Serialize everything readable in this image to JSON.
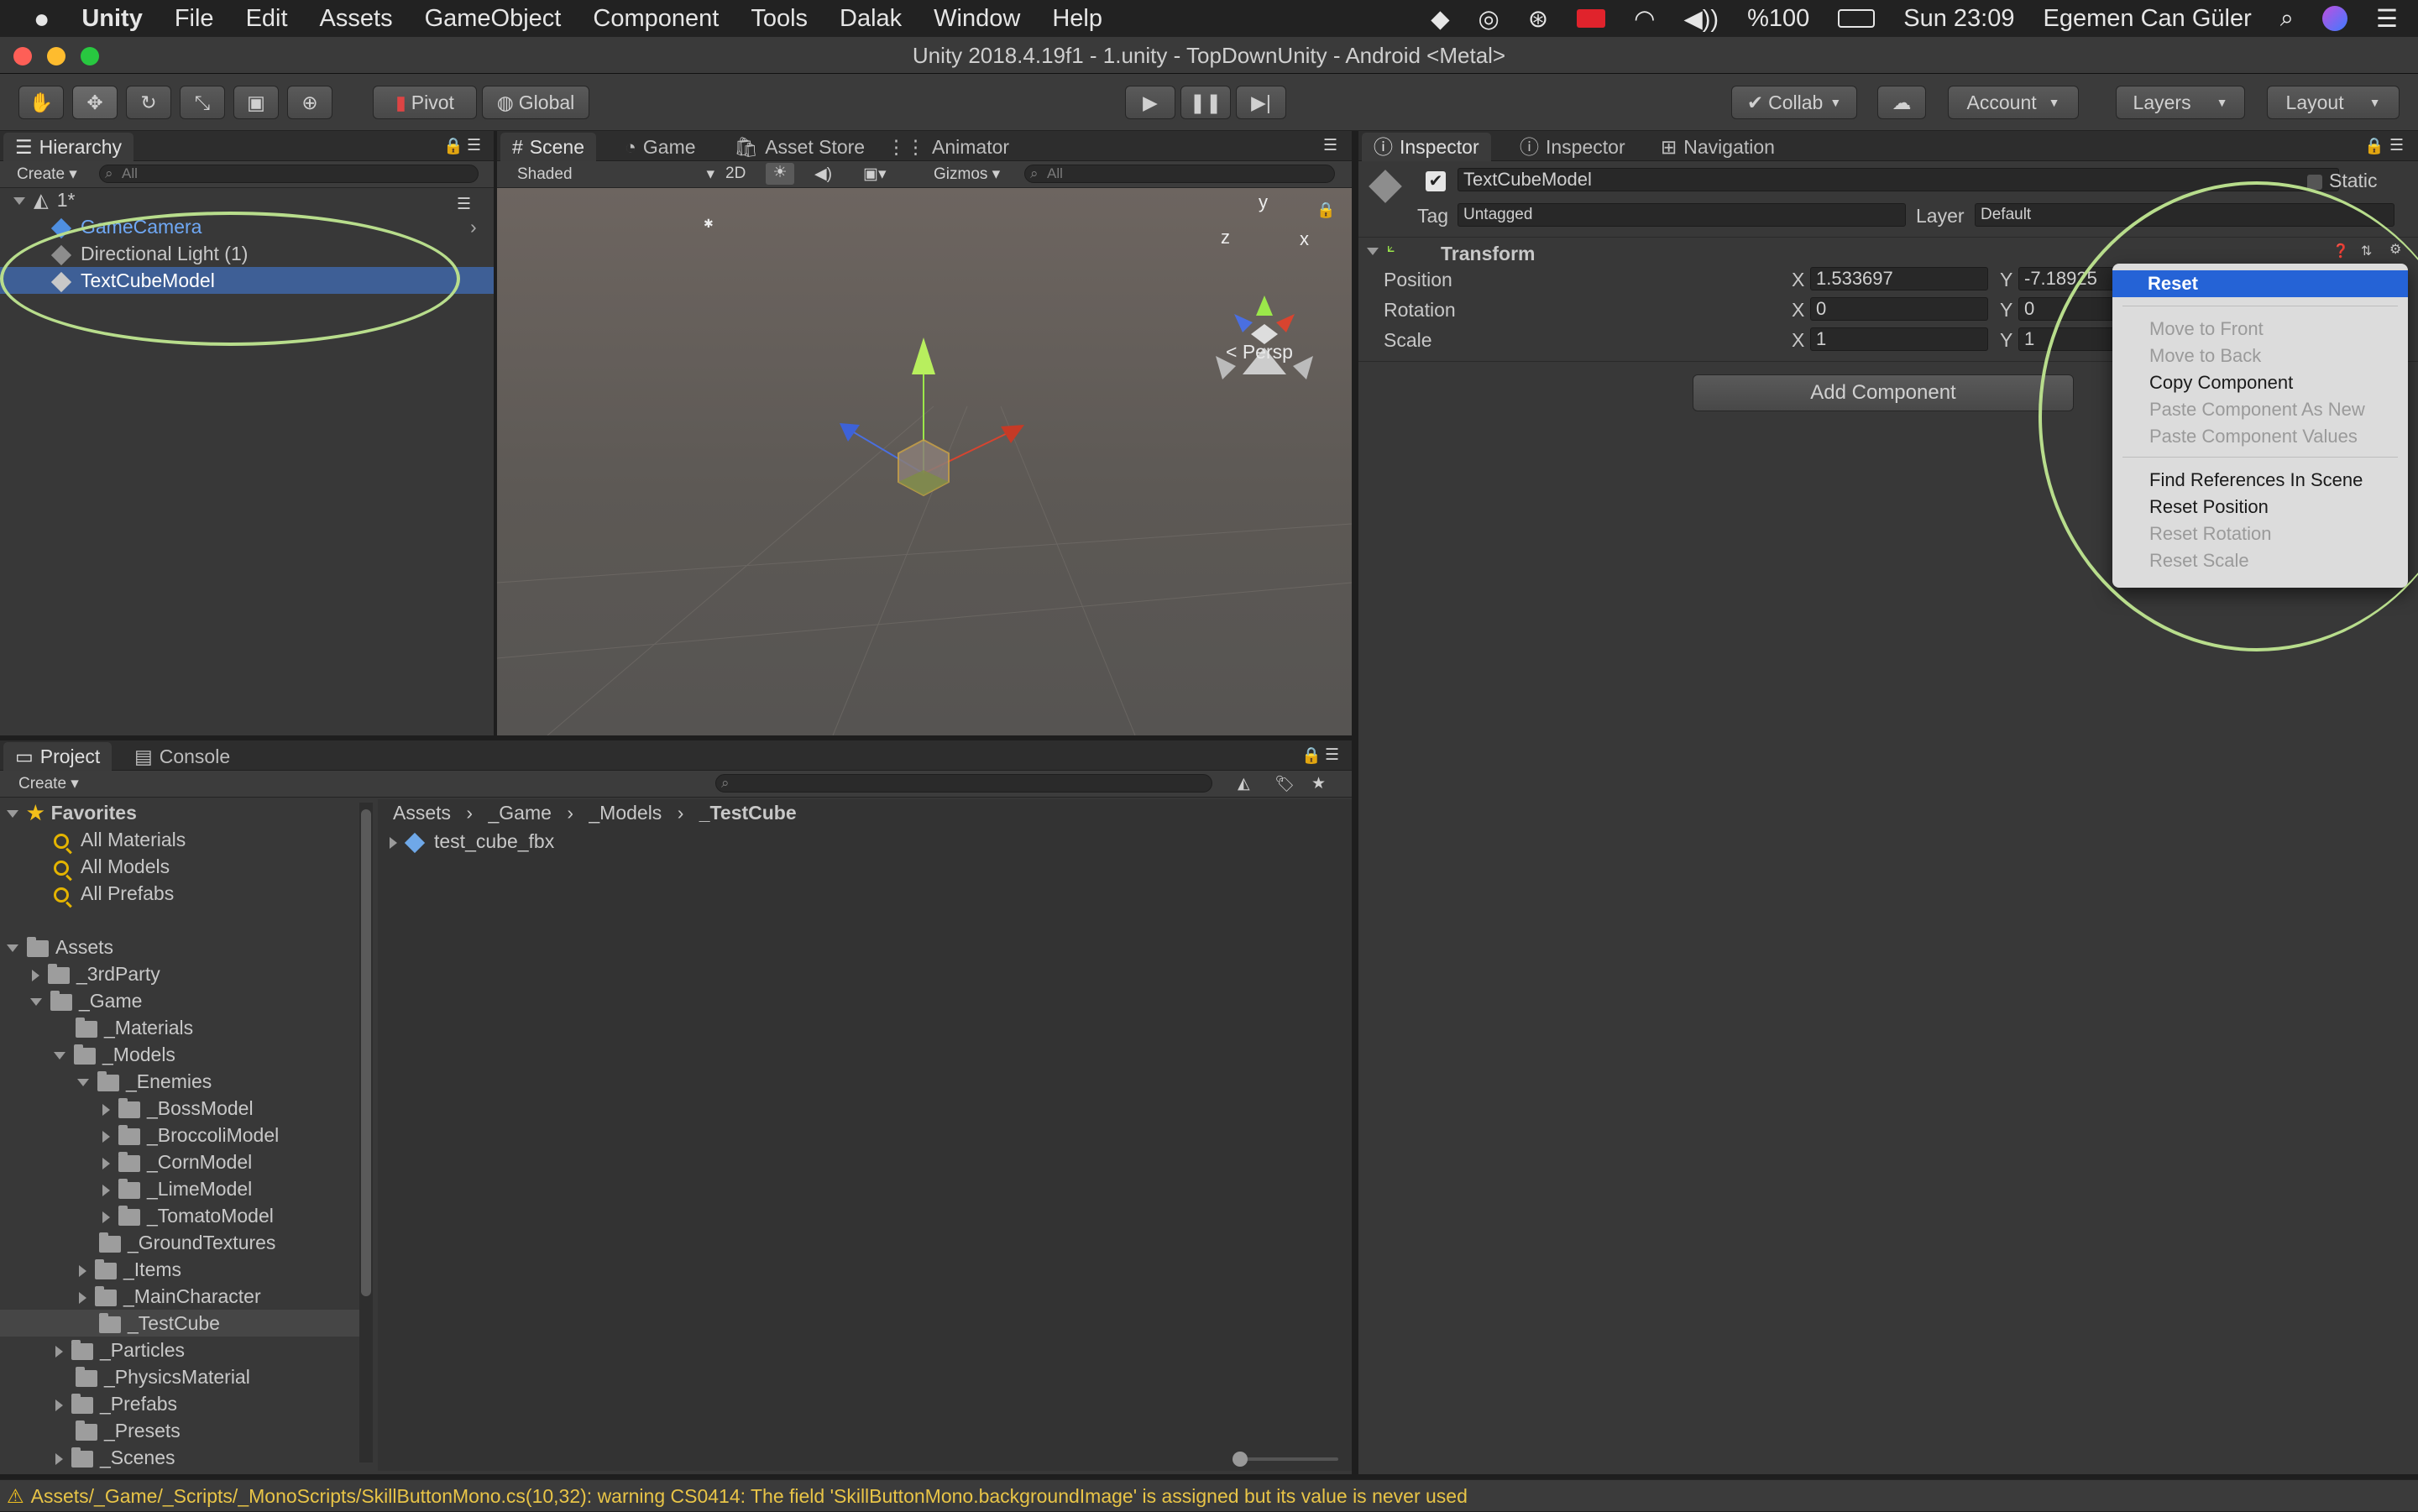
{
  "menubar": {
    "app": "Unity",
    "items": [
      "File",
      "Edit",
      "Assets",
      "GameObject",
      "Component",
      "Tools",
      "Dalak",
      "Window",
      "Help"
    ],
    "battery": "%100",
    "clock": "Sun 23:09",
    "user": "Egemen Can Güler"
  },
  "window": {
    "title": "Unity 2018.4.19f1 - 1.unity - TopDownUnity - Android <Metal>"
  },
  "toolbar": {
    "pivot": "Pivot",
    "global": "Global",
    "collab": "Collab",
    "account": "Account",
    "layers": "Layers",
    "layout": "Layout"
  },
  "hierarchy": {
    "tab": "Hierarchy",
    "create": "Create",
    "search_placeholder": "All",
    "scene": "1*",
    "items": [
      "GameCamera",
      "Directional Light (1)",
      "TextCubeModel"
    ]
  },
  "scene": {
    "tabs": [
      "Scene",
      "Game",
      "Asset Store",
      "Animator"
    ],
    "shading": "Shaded",
    "mode2d": "2D",
    "gizmos": "Gizmos",
    "search_placeholder": "All",
    "persp": "Persp",
    "axis_y": "y",
    "axis_x": "x",
    "axis_z": "z"
  },
  "inspector": {
    "tabs": [
      "Inspector",
      "Inspector",
      "Navigation"
    ],
    "object_name": "TextCubeModel",
    "static": "Static",
    "tag_label": "Tag",
    "tag_value": "Untagged",
    "layer_label": "Layer",
    "layer_value": "Default",
    "component": "Transform",
    "position_label": "Position",
    "rotation_label": "Rotation",
    "scale_label": "Scale",
    "x": "X",
    "y": "Y",
    "pos_x": "1.533697",
    "pos_y": "-7.18925",
    "rot_x": "0",
    "rot_y": "0",
    "scale_x": "1",
    "scale_y": "1",
    "add_component": "Add Component"
  },
  "context_menu": {
    "items": [
      "Reset",
      "Move to Front",
      "Move to Back",
      "Copy Component",
      "Paste Component As New",
      "Paste Component Values",
      "Find References In Scene",
      "Reset Position",
      "Reset Rotation",
      "Reset Scale"
    ]
  },
  "project": {
    "tabs": [
      "Project",
      "Console"
    ],
    "create": "Create",
    "favorites": "Favorites",
    "fav_items": [
      "All Materials",
      "All Models",
      "All Prefabs"
    ],
    "assets": "Assets",
    "tree": [
      "_3rdParty",
      "_Game",
      "_Materials",
      "_Models",
      "_Enemies",
      "_BossModel",
      "_BroccoliModel",
      "_CornModel",
      "_LimeModel",
      "_TomatoModel",
      "_GroundTextures",
      "_Items",
      "_MainCharacter",
      "_TestCube",
      "_Particles",
      "_PhysicsMaterial",
      "_Prefabs",
      "_Presets",
      "_Scenes"
    ],
    "breadcrumb": [
      "Assets",
      "_Game",
      "_Models",
      "_TestCube"
    ],
    "files": [
      "test_cube_fbx"
    ]
  },
  "status": {
    "message": "Assets/_Game/_Scripts/_MonoScripts/SkillButtonMono.cs(10,32): warning CS0414: The field 'SkillButtonMono.backgroundImage' is assigned but its value is never used"
  },
  "colors": {
    "selection": "#3e5f96",
    "menu_highlight": "#2563d6",
    "annotation_ring": "#b8dd8c",
    "warning": "#e4b400"
  }
}
